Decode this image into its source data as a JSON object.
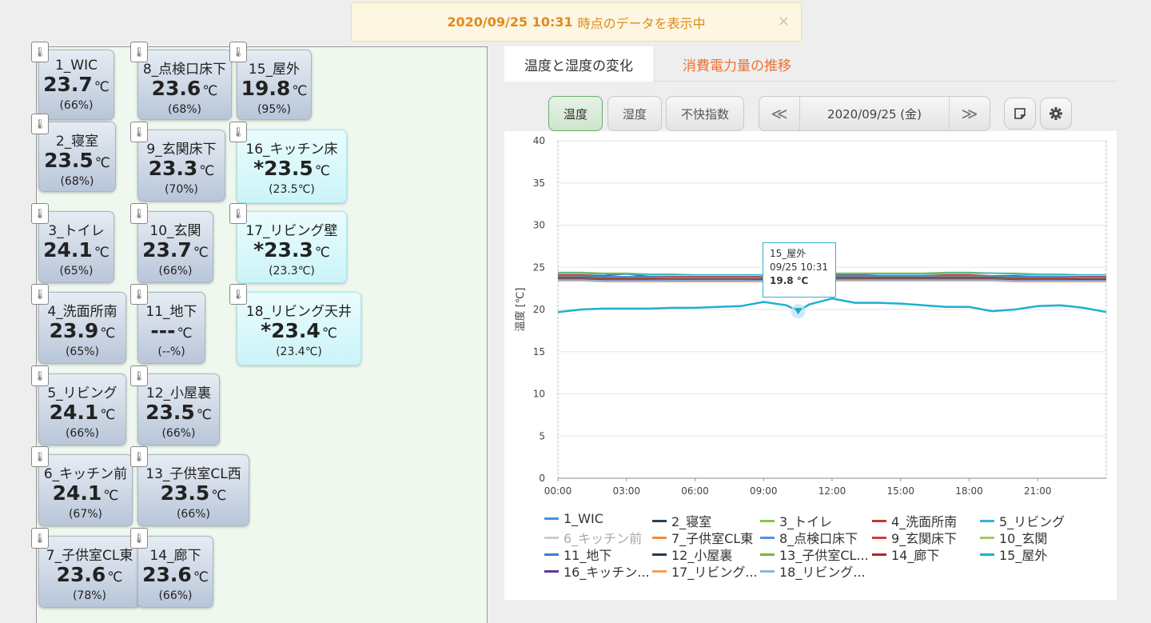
{
  "notice": {
    "datetime": "2020/09/25 10:31",
    "message": "時点のデータを表示中",
    "close": "×"
  },
  "thermometer_icon": "thermometer-icon",
  "sensors": [
    {
      "name": "1_WIC",
      "temp": "23.7",
      "unit": "℃",
      "humidity": "(66%)"
    },
    {
      "name": "8_点検口床下",
      "temp": "23.6",
      "unit": "℃",
      "humidity": "(68%)"
    },
    {
      "name": "15_屋外",
      "temp": "19.8",
      "unit": "℃",
      "humidity": "(95%)"
    },
    {
      "name": "2_寝室",
      "temp": "23.5",
      "unit": "℃",
      "humidity": "(68%)"
    },
    {
      "name": "9_玄関床下",
      "temp": "23.3",
      "unit": "℃",
      "humidity": "(70%)"
    },
    {
      "name": "16_キッチン床",
      "temp": "*23.5",
      "unit": "℃",
      "humidity": "(23.5℃)"
    },
    {
      "name": "3_トイレ",
      "temp": "24.1",
      "unit": "℃",
      "humidity": "(65%)"
    },
    {
      "name": "10_玄関",
      "temp": "23.7",
      "unit": "℃",
      "humidity": "(66%)"
    },
    {
      "name": "17_リビング壁",
      "temp": "*23.3",
      "unit": "℃",
      "humidity": "(23.3℃)"
    },
    {
      "name": "4_洗面所南",
      "temp": "23.9",
      "unit": "℃",
      "humidity": "(65%)"
    },
    {
      "name": "11_地下",
      "temp": "---",
      "unit": "℃",
      "humidity": "(--%)"
    },
    {
      "name": "18_リビング天井",
      "temp": "*23.4",
      "unit": "℃",
      "humidity": "(23.4℃)"
    },
    {
      "name": "5_リビング",
      "temp": "24.1",
      "unit": "℃",
      "humidity": "(66%)"
    },
    {
      "name": "12_小屋裏",
      "temp": "23.5",
      "unit": "℃",
      "humidity": "(66%)"
    },
    {
      "name": "6_キッチン前",
      "temp": "24.1",
      "unit": "℃",
      "humidity": "(67%)"
    },
    {
      "name": "13_子供室CL西",
      "temp": "23.5",
      "unit": "℃",
      "humidity": "(66%)"
    },
    {
      "name": "7_子供室CL東",
      "temp": "23.6",
      "unit": "℃",
      "humidity": "(78%)"
    },
    {
      "name": "14_廊下",
      "temp": "23.6",
      "unit": "℃",
      "humidity": "(66%)"
    }
  ],
  "tabs": {
    "active": "温度と湿度の変化",
    "other": "消費電力量の推移"
  },
  "controls": {
    "temp": "温度",
    "humidity": "湿度",
    "discomfort": "不快指数",
    "prev": "≪",
    "date": "2020/09/25 (金)",
    "next": "≫",
    "note_icon": "note-icon",
    "settings_icon": "gear-icon"
  },
  "chart_data": {
    "type": "line",
    "ylabel": "温度 [℃]",
    "ylim": [
      0,
      40
    ],
    "yticks": [
      "0",
      "5",
      "10",
      "15",
      "20",
      "25",
      "30",
      "35",
      "40"
    ],
    "xlim": [
      "00:00",
      "24:00"
    ],
    "xticks": [
      "00:00",
      "03:00",
      "06:00",
      "09:00",
      "12:00",
      "15:00",
      "18:00",
      "21:00"
    ],
    "grid": true,
    "legend_position": "bottom",
    "x": [
      "00:00",
      "01:00",
      "02:00",
      "03:00",
      "04:00",
      "05:00",
      "06:00",
      "07:00",
      "08:00",
      "09:00",
      "10:00",
      "10:31",
      "11:00",
      "12:00",
      "13:00",
      "14:00",
      "15:00",
      "16:00",
      "17:00",
      "18:00",
      "19:00",
      "20:00",
      "21:00",
      "22:00",
      "23:00",
      "24:00"
    ],
    "series": [
      {
        "name": "1_WIC",
        "color": "#4a90d9",
        "values": [
          23.9,
          23.9,
          23.8,
          23.8,
          23.8,
          23.7,
          23.7,
          23.7,
          23.7,
          23.8,
          23.7,
          23.7,
          23.8,
          23.9,
          23.9,
          23.9,
          23.9,
          23.9,
          23.9,
          23.9,
          23.9,
          23.9,
          23.8,
          23.8,
          23.7,
          23.7
        ]
      },
      {
        "name": "2_寝室",
        "color": "#2c3e5c",
        "values": [
          23.8,
          23.8,
          23.7,
          23.7,
          23.6,
          23.6,
          23.6,
          23.5,
          23.5,
          23.6,
          23.5,
          23.5,
          23.6,
          23.7,
          23.8,
          23.8,
          23.8,
          23.8,
          23.8,
          23.8,
          23.8,
          23.7,
          23.6,
          23.6,
          23.5,
          23.5
        ]
      },
      {
        "name": "3_トイレ",
        "color": "#8bc34a",
        "values": [
          24.4,
          24.4,
          24.3,
          24.3,
          24.2,
          24.2,
          24.1,
          24.1,
          24.1,
          24.1,
          24.1,
          24.1,
          24.2,
          24.3,
          24.3,
          24.3,
          24.3,
          24.3,
          24.4,
          24.4,
          24.3,
          24.3,
          24.2,
          24.2,
          24.1,
          24.1
        ]
      },
      {
        "name": "4_洗面所南",
        "color": "#c0392b",
        "values": [
          24.1,
          24.1,
          24.0,
          24.2,
          23.9,
          23.9,
          23.9,
          23.9,
          23.9,
          23.9,
          23.9,
          23.9,
          24.0,
          24.1,
          24.1,
          24.0,
          24.0,
          24.0,
          24.1,
          24.1,
          24.0,
          24.0,
          23.9,
          23.9,
          23.9,
          23.9
        ]
      },
      {
        "name": "5_リビング",
        "color": "#29b6d8",
        "values": [
          24.3,
          24.3,
          24.2,
          24.2,
          24.1,
          24.1,
          24.1,
          24.1,
          24.1,
          24.1,
          24.1,
          24.1,
          24.2,
          24.2,
          24.2,
          24.2,
          24.2,
          24.2,
          24.3,
          24.3,
          24.3,
          24.2,
          24.1,
          24.1,
          24.1,
          24.1
        ]
      },
      {
        "name": "6_キッチン前",
        "color": "#bbbbbb",
        "hidden": true,
        "values": [
          24.3,
          24.3,
          24.2,
          24.2,
          24.1,
          24.1,
          24.1,
          24.1,
          24.1,
          24.1,
          24.1,
          24.1,
          24.2,
          24.2,
          24.2,
          24.2,
          24.2,
          24.2,
          24.3,
          24.3,
          24.3,
          24.2,
          24.1,
          24.1,
          24.1,
          24.1
        ]
      },
      {
        "name": "7_子供室CL東",
        "color": "#f28c38",
        "values": [
          23.7,
          23.7,
          23.6,
          23.6,
          23.6,
          23.5,
          23.5,
          23.5,
          23.5,
          23.6,
          23.6,
          23.6,
          23.6,
          23.7,
          23.7,
          23.7,
          23.7,
          23.7,
          23.7,
          23.7,
          23.7,
          23.6,
          23.6,
          23.6,
          23.6,
          23.6
        ]
      },
      {
        "name": "8_点検口床下",
        "color": "#5b8fd6",
        "values": [
          23.8,
          23.8,
          23.7,
          23.7,
          23.7,
          23.6,
          23.6,
          23.6,
          23.6,
          23.6,
          23.6,
          23.6,
          23.7,
          23.8,
          23.8,
          23.8,
          23.8,
          23.8,
          23.8,
          23.8,
          23.8,
          23.7,
          23.7,
          23.7,
          23.6,
          23.6
        ]
      },
      {
        "name": "9_玄関床下",
        "color": "#d63a3a",
        "values": [
          23.5,
          23.5,
          23.4,
          23.4,
          23.4,
          23.3,
          23.3,
          23.3,
          23.3,
          23.3,
          23.3,
          23.3,
          23.4,
          23.5,
          23.5,
          23.5,
          23.5,
          23.5,
          23.5,
          23.5,
          23.5,
          23.4,
          23.4,
          23.4,
          23.3,
          23.3
        ]
      },
      {
        "name": "10_玄関",
        "color": "#a5c86a",
        "values": [
          23.9,
          23.9,
          23.8,
          23.8,
          23.8,
          23.7,
          23.7,
          23.7,
          23.7,
          23.7,
          23.7,
          23.7,
          23.8,
          23.9,
          23.9,
          23.9,
          23.9,
          23.9,
          23.9,
          23.9,
          23.9,
          23.8,
          23.8,
          23.8,
          23.7,
          23.7
        ]
      },
      {
        "name": "11_地下",
        "color": "#3e7fcf",
        "values": [
          24.0,
          24.0,
          23.9,
          23.9,
          23.9,
          23.8,
          23.8,
          23.8,
          23.8,
          23.8,
          23.8,
          23.8,
          23.9,
          24.0,
          24.0,
          24.0,
          24.0,
          24.0,
          24.0,
          24.0,
          24.0,
          23.9,
          23.9,
          23.9,
          23.8,
          23.8
        ]
      },
      {
        "name": "12_小屋裏",
        "color": "#243a5a",
        "values": [
          23.7,
          23.7,
          23.6,
          23.6,
          23.6,
          23.5,
          23.5,
          23.5,
          23.5,
          23.5,
          23.5,
          23.5,
          23.6,
          23.7,
          23.7,
          23.7,
          23.7,
          23.7,
          23.7,
          23.7,
          23.7,
          23.6,
          23.6,
          23.6,
          23.5,
          23.5
        ]
      },
      {
        "name": "13_子供室CL...",
        "color": "#7cb342",
        "values": [
          23.7,
          23.7,
          23.6,
          23.6,
          23.6,
          23.5,
          23.5,
          23.5,
          23.5,
          23.5,
          23.5,
          23.5,
          23.6,
          23.7,
          23.7,
          23.7,
          23.7,
          23.7,
          23.7,
          23.7,
          23.7,
          23.6,
          23.6,
          23.6,
          23.5,
          23.5
        ]
      },
      {
        "name": "14_廊下",
        "color": "#a52a2a",
        "values": [
          23.8,
          23.8,
          23.7,
          23.7,
          23.7,
          23.6,
          23.6,
          23.6,
          23.6,
          23.6,
          23.6,
          23.6,
          23.7,
          23.8,
          23.8,
          23.8,
          23.8,
          23.8,
          23.8,
          23.8,
          23.8,
          23.7,
          23.7,
          23.7,
          23.6,
          23.6
        ]
      },
      {
        "name": "15_屋外",
        "color": "#1fb0d0",
        "values": [
          19.7,
          20.0,
          20.1,
          20.1,
          20.1,
          20.2,
          20.2,
          20.3,
          20.4,
          20.9,
          20.5,
          19.8,
          20.6,
          21.3,
          20.8,
          20.8,
          20.7,
          20.5,
          20.3,
          20.3,
          19.8,
          20.0,
          20.4,
          20.5,
          20.2,
          19.7
        ]
      },
      {
        "name": "16_キッチン...",
        "color": "#5e3c8e",
        "values": [
          23.6,
          23.6,
          23.5,
          23.5,
          23.5,
          23.4,
          23.4,
          23.4,
          23.4,
          23.5,
          23.5,
          23.5,
          23.5,
          23.6,
          23.6,
          23.6,
          23.6,
          23.6,
          23.6,
          23.6,
          23.6,
          23.5,
          23.5,
          23.5,
          23.5,
          23.5
        ]
      },
      {
        "name": "17_リビング...",
        "color": "#f5a052",
        "values": [
          23.4,
          23.4,
          23.3,
          23.3,
          23.3,
          23.3,
          23.3,
          23.3,
          23.3,
          23.3,
          23.3,
          23.3,
          23.3,
          23.4,
          23.4,
          23.4,
          23.4,
          23.4,
          23.4,
          23.4,
          23.4,
          23.3,
          23.3,
          23.3,
          23.3,
          23.3
        ]
      },
      {
        "name": "18_リビング...",
        "color": "#8ab4e8",
        "values": [
          23.5,
          23.5,
          23.4,
          23.4,
          23.4,
          23.4,
          23.4,
          23.4,
          23.4,
          23.4,
          23.4,
          23.4,
          23.4,
          23.5,
          23.5,
          23.5,
          23.5,
          23.5,
          23.5,
          23.5,
          23.5,
          23.4,
          23.4,
          23.4,
          23.4,
          23.4
        ]
      }
    ],
    "tooltip": {
      "series": "15_屋外",
      "time": "09/25 10:31",
      "value": "19.8 ℃"
    }
  }
}
